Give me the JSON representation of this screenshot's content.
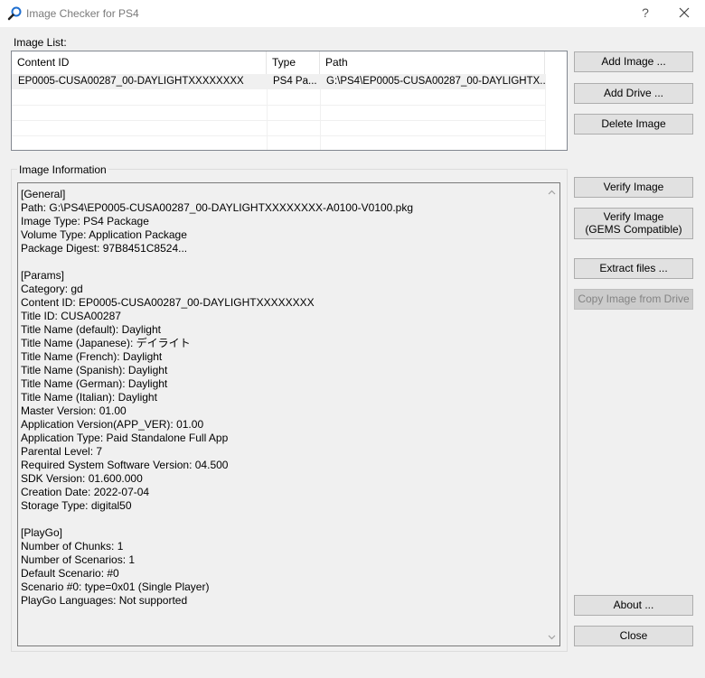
{
  "window": {
    "title": "Image Checker for PS4",
    "help_label": "?",
    "close_label": "×"
  },
  "image_list": {
    "label": "Image List:",
    "columns": [
      "Content ID",
      "Type",
      "Path"
    ],
    "rows": [
      {
        "content_id": "EP0005-CUSA00287_00-DAYLIGHTXXXXXXXX",
        "type": "PS4 Pa...",
        "path": "G:\\PS4\\EP0005-CUSA00287_00-DAYLIGHTX..."
      }
    ]
  },
  "image_info": {
    "label": "Image Information",
    "text": "[General]\nPath: G:\\PS4\\EP0005-CUSA00287_00-DAYLIGHTXXXXXXXX-A0100-V0100.pkg\nImage Type: PS4 Package\nVolume Type: Application Package\nPackage Digest: 97B8451C8524...\n\n[Params]\nCategory: gd\nContent ID: EP0005-CUSA00287_00-DAYLIGHTXXXXXXXX\nTitle ID: CUSA00287\nTitle Name (default): Daylight\nTitle Name (Japanese): デイライト\nTitle Name (French): Daylight\nTitle Name (Spanish): Daylight\nTitle Name (German): Daylight\nTitle Name (Italian): Daylight\nMaster Version: 01.00\nApplication Version(APP_VER): 01.00\nApplication Type: Paid Standalone Full App\nParental Level: 7\nRequired System Software Version: 04.500\nSDK Version: 01.600.000\nCreation Date: 2022-07-04\nStorage Type: digital50\n\n[PlayGo]\nNumber of Chunks: 1\nNumber of Scenarios: 1\nDefault Scenario: #0\nScenario #0: type=0x01 (Single Player)\nPlayGo Languages: Not supported"
  },
  "buttons": {
    "add_image": "Add Image ...",
    "add_drive": "Add Drive ...",
    "delete_image": "Delete Image",
    "verify_image": "Verify Image",
    "verify_gems_line1": "Verify Image",
    "verify_gems_line2": "(GEMS Compatible)",
    "extract_files": "Extract files ...",
    "copy_from_drive": "Copy Image from Drive",
    "about": "About ...",
    "close": "Close"
  },
  "icons": {
    "app": "magnifier-icon",
    "help": "help-icon",
    "close": "close-icon"
  },
  "colors": {
    "app_icon_accent": "#1f6fd0",
    "disabled_text": "#838383",
    "selection": "#f0f0f0"
  }
}
